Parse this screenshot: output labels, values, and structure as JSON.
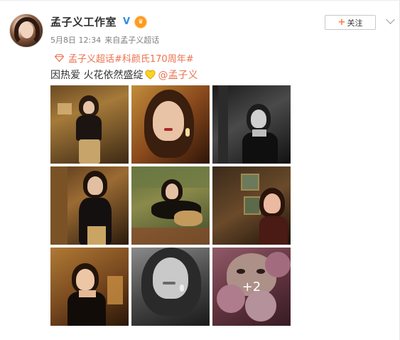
{
  "post": {
    "username": "孟子义工作室",
    "verified_icon": "verified-v-icon",
    "vip_icon": "member-crown-icon",
    "date": "5月8日 12:34",
    "source_prefix": "来自",
    "source": "孟子义超话",
    "follow_label": "关注",
    "topic_icon": "super-topic-diamond-icon",
    "topic_text": "孟子义超话#科颜氏170周年#",
    "text_before": "因热爱 火花依然盛绽",
    "heart_icon": "yellow-heart-icon",
    "mention": "@孟子义",
    "more_count": "+2"
  },
  "colors": {
    "accent": "#eb7350",
    "verified_blue": "#2f8de4",
    "heart_yellow": "#ffd21f",
    "text": "#333333",
    "meta": "#808080"
  },
  "photos": [
    {
      "name": "photo-1",
      "tone": "warm-gold"
    },
    {
      "name": "photo-2",
      "tone": "warm-amber"
    },
    {
      "name": "photo-3",
      "tone": "black-white"
    },
    {
      "name": "photo-4",
      "tone": "dark-warm"
    },
    {
      "name": "photo-5",
      "tone": "olive-green"
    },
    {
      "name": "photo-6",
      "tone": "dark-red"
    },
    {
      "name": "photo-7",
      "tone": "warm-gold"
    },
    {
      "name": "photo-8",
      "tone": "black-white"
    },
    {
      "name": "photo-9",
      "tone": "pink-flowers"
    }
  ]
}
